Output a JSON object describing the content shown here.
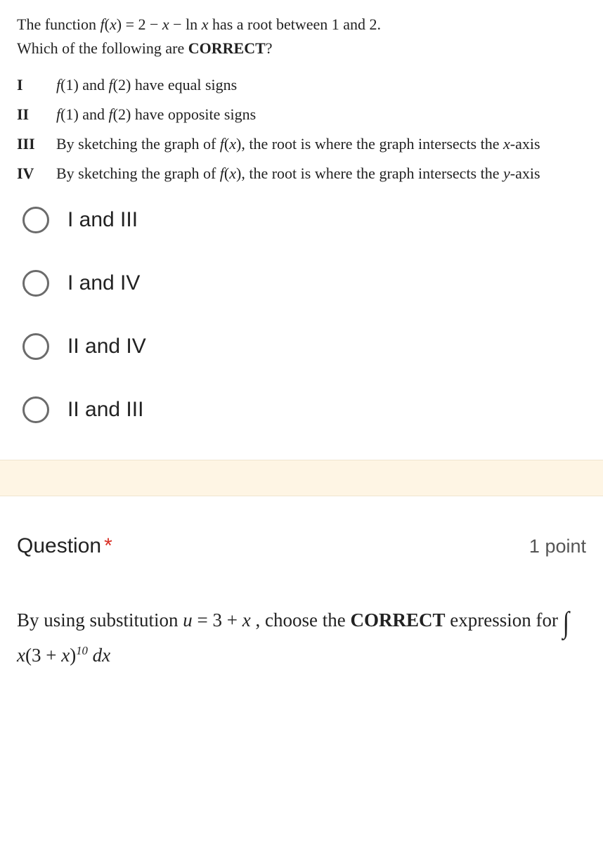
{
  "q1": {
    "stem_line1_a": "The function  ",
    "stem_line1_b": "f",
    "stem_line1_c": "(",
    "stem_line1_d": "x",
    "stem_line1_e": ") = 2 − ",
    "stem_line1_f": "x",
    "stem_line1_g": " − ln ",
    "stem_line1_h": "x",
    "stem_line1_i": "  has a root between 1 and 2.",
    "stem_line2_a": "Which of the following are ",
    "stem_line2_b": "CORRECT",
    "stem_line2_c": "?",
    "statements": {
      "s1_num": "I",
      "s1_a": "f",
      "s1_b": "(1) and  ",
      "s1_c": "f",
      "s1_d": "(2) have equal signs",
      "s2_num": "II",
      "s2_a": "f",
      "s2_b": "(1) and  ",
      "s2_c": "f",
      "s2_d": "(2) have opposite signs",
      "s3_num": "III",
      "s3_a": "By sketching the graph of  ",
      "s3_b": "f",
      "s3_c": "(",
      "s3_d": "x",
      "s3_e": "), the root is where the graph intersects the ",
      "s3_f": "x",
      "s3_g": "-axis",
      "s4_num": "IV",
      "s4_a": "By sketching the graph of  ",
      "s4_b": "f",
      "s4_c": "(",
      "s4_d": "x",
      "s4_e": "), the root is where the graph intersects the ",
      "s4_f": "y",
      "s4_g": "-axis"
    },
    "options": {
      "o1": "I and III",
      "o2": "I and IV",
      "o3": "II and IV",
      "o4": "II and III"
    }
  },
  "q2": {
    "title": "Question",
    "star": "*",
    "points": "1 point",
    "stem_a": "By using substitution  ",
    "stem_b": "u",
    "stem_c": " = 3 + ",
    "stem_d": "x",
    "stem_e": " , choose the ",
    "stem_f": "CORRECT",
    "stem_g": " expression for  ",
    "stem_int": "∫",
    "stem_h": "x",
    "stem_i": "(3 + ",
    "stem_j": "x",
    "stem_k": ")",
    "stem_exp": "10",
    "stem_l": " d",
    "stem_m": "x"
  }
}
